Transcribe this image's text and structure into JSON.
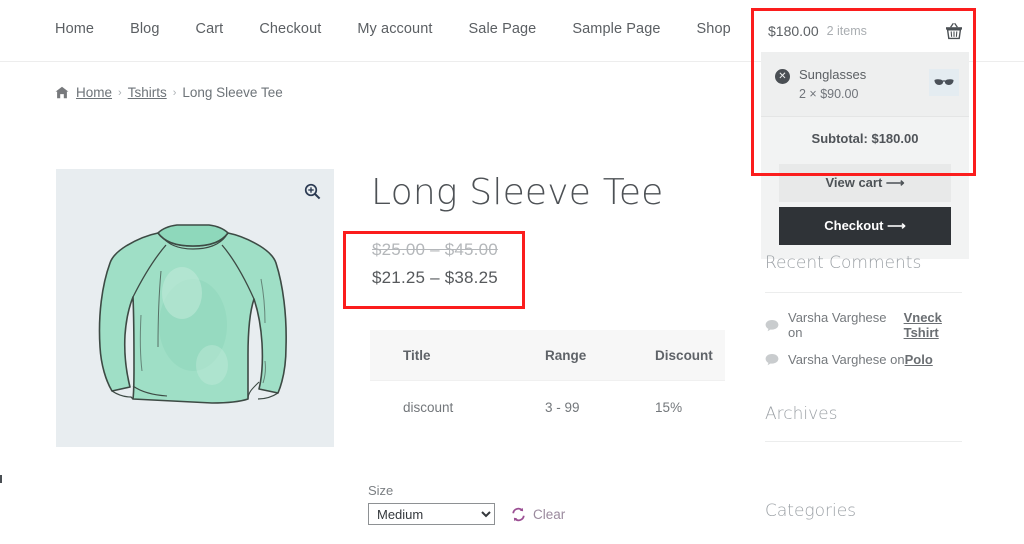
{
  "nav": {
    "items": [
      {
        "label": "Home"
      },
      {
        "label": "Blog"
      },
      {
        "label": "Cart"
      },
      {
        "label": "Checkout"
      },
      {
        "label": "My account"
      },
      {
        "label": "Sale Page"
      },
      {
        "label": "Sample Page"
      },
      {
        "label": "Shop"
      }
    ]
  },
  "breadcrumb": {
    "home_icon": "home-icon",
    "home": "Home",
    "separator": "›",
    "category": "Tshirts",
    "current": "Long Sleeve Tee"
  },
  "gallery": {
    "zoom_icon": "magnifier-plus-icon",
    "background_color": "#e8edf0",
    "shirt_color": "#a8e0cb"
  },
  "product": {
    "title": "Long Sleeve Tee",
    "price_original": "$25.00 – $45.00",
    "price_sale": "$21.25 – $38.25"
  },
  "discount_table": {
    "headers": [
      "Title",
      "Range",
      "Discount"
    ],
    "rows": [
      {
        "title": "discount",
        "range": "3 - 99",
        "discount": "15%"
      }
    ]
  },
  "variations": {
    "size_label": "Size",
    "size_value": "Medium",
    "size_options": [
      "Medium"
    ],
    "clear_label": "Clear",
    "clear_icon": "refresh-icon"
  },
  "cart": {
    "total": "$180.00",
    "count": "2 items",
    "basket_icon": "shopping-basket-icon",
    "remove_icon": "close-circle-icon",
    "item_name": "Sunglasses",
    "item_qty": "2 × $90.00",
    "item_thumb_icon": "sunglasses-icon",
    "subtotal": "Subtotal: $180.00",
    "view_cart_label": "View cart  ⟶",
    "checkout_label": "Checkout  ⟶"
  },
  "sidebar": {
    "recent_comments_heading": "Recent Comments",
    "comments": [
      {
        "icon": "comment-bubble-icon",
        "text": "Varsha Varghese on ",
        "link": "Vneck Tshirt"
      },
      {
        "icon": "comment-bubble-icon",
        "text": "Varsha Varghese on ",
        "link": "Polo"
      }
    ],
    "archives_heading": "Archives",
    "categories_heading": "Categories"
  },
  "annotations": {
    "color": "#fb1d1d",
    "boxes": [
      "cart-widget-highlight",
      "price-highlight"
    ]
  }
}
